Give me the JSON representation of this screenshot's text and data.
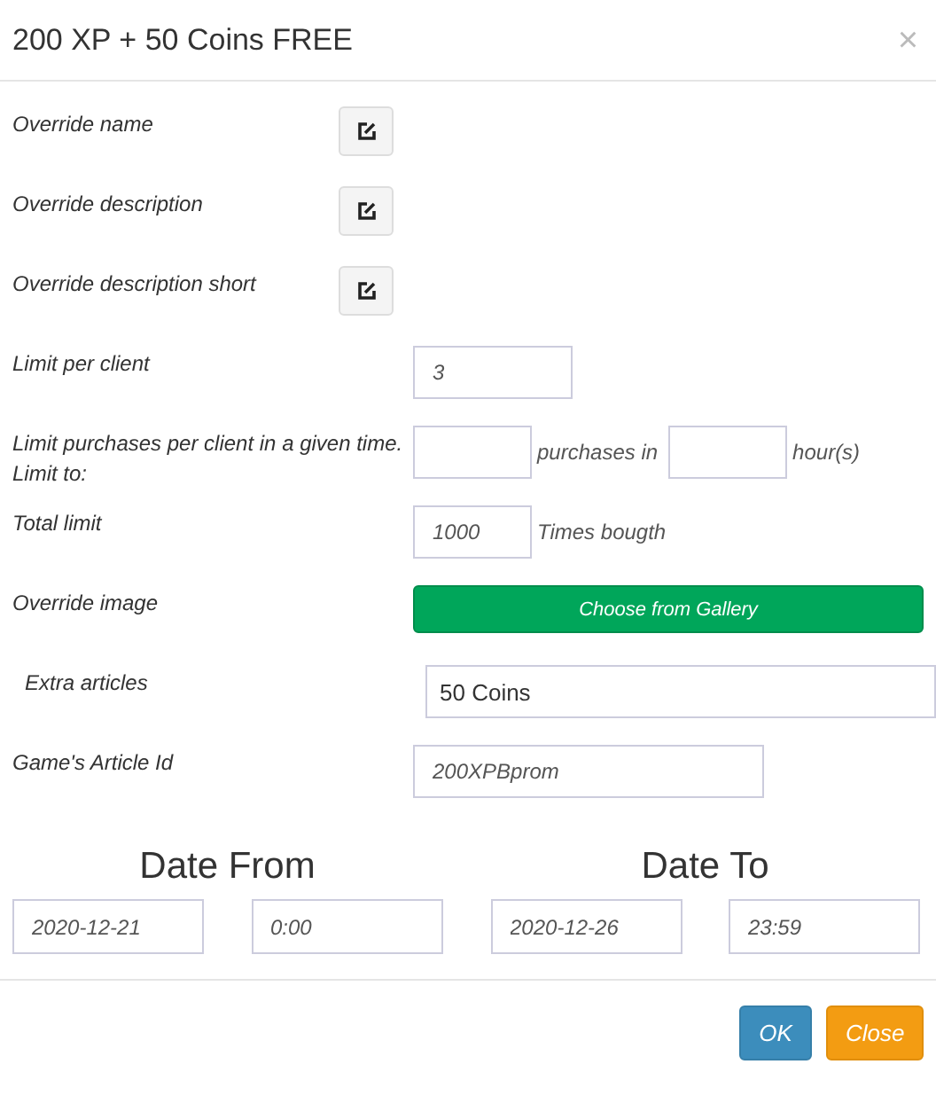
{
  "window": {
    "title": "200 XP + 50 Coins FREE",
    "close": "×"
  },
  "rows": [
    {
      "kind": "edit",
      "label": "Override name"
    },
    {
      "kind": "edit",
      "label": "Override description"
    },
    {
      "kind": "edit",
      "label": "Override description short"
    },
    {
      "kind": "input",
      "label": "Limit per client",
      "value": "3"
    },
    {
      "kind": "rate",
      "label": "Limit purchases per client in a given time. Limit to:",
      "middle": "purchases in",
      "unit": "hour(s)"
    },
    {
      "kind": "total",
      "label": "Total limit",
      "value": "1000",
      "suffix": "Times bougth"
    },
    {
      "kind": "gallery",
      "label": "Override image",
      "button": "Choose from Gallery"
    },
    {
      "kind": "wide",
      "label": "Extra articles",
      "value": "50 Coins"
    },
    {
      "kind": "medium",
      "label": "Game's Article Id",
      "value": "200XPBprom"
    }
  ],
  "dates": [
    {
      "heading": "Date From",
      "date": "2020-12-21",
      "time": "0:00"
    },
    {
      "heading": "Date To",
      "date": "2020-12-26",
      "time": "23:59"
    }
  ],
  "buttons": [
    {
      "kind": "primary",
      "label": "OK"
    },
    {
      "kind": "warning",
      "label": "Close"
    }
  ]
}
